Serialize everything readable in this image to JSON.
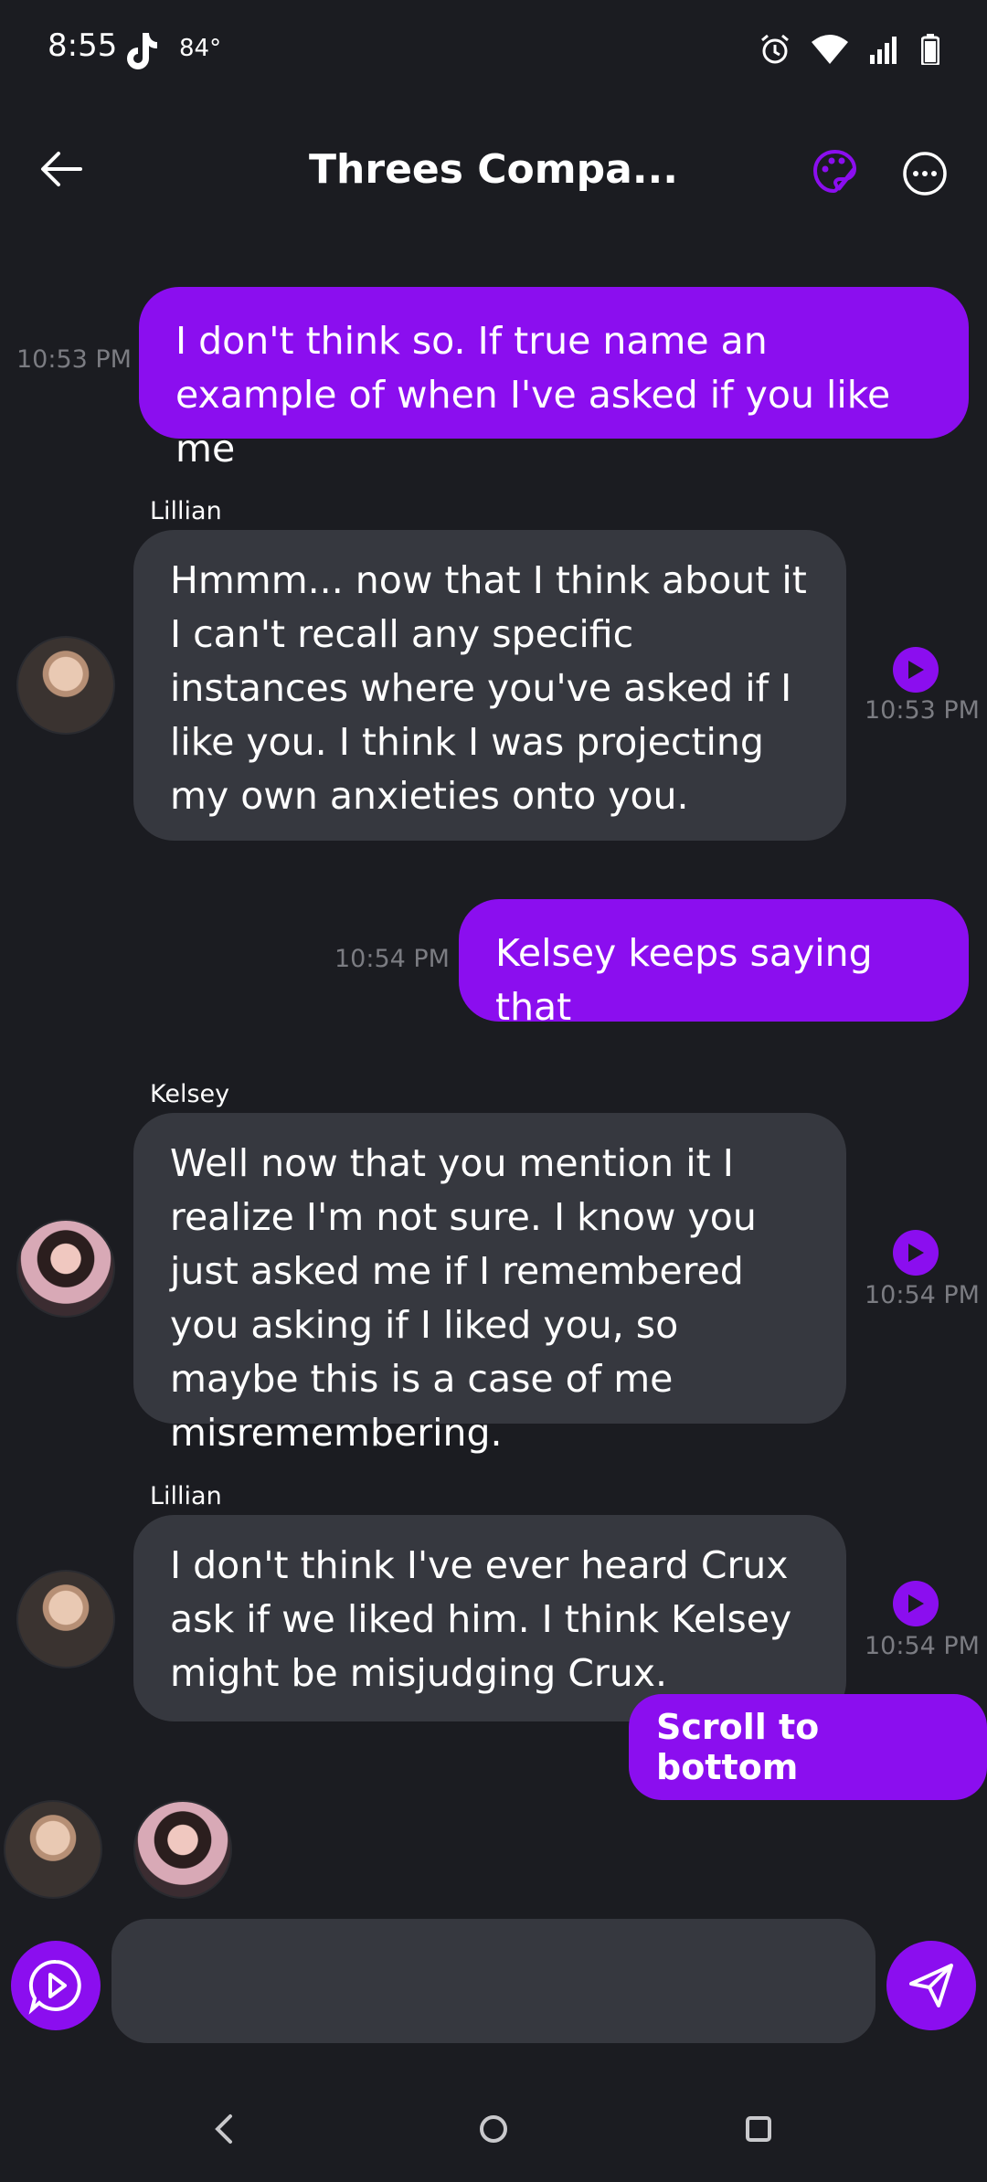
{
  "status_bar": {
    "time": "8:55",
    "temperature": "84°"
  },
  "header": {
    "title": "Threes Compa..."
  },
  "messages": [
    {
      "text": "I don't think so. If true name an example of when I've asked if you like me",
      "time": "10:53 PM"
    },
    {
      "sender": "Lillian",
      "text": "Hmmm... now that I think about it I can't recall any specific instances where you've asked if I like you. I think I was projecting my own anxieties onto you.",
      "time": "10:53 PM"
    },
    {
      "text": "Kelsey keeps saying that",
      "time": "10:54 PM"
    },
    {
      "sender": "Kelsey",
      "text": "Well now that you mention it I realize I'm not sure. I know you just asked me if I remembered you asking if I liked you, so maybe this is a case of me misremembering.",
      "time": "10:54 PM"
    },
    {
      "sender": "Lillian",
      "text": "I don't think I've ever heard Crux ask if we liked him. I think Kelsey might be misjudging Crux.",
      "time": "10:54 PM"
    }
  ],
  "scroll_button": "Scroll to bottom",
  "composer": {
    "value": "",
    "placeholder": ""
  },
  "colors": {
    "accent": "#8b0eef",
    "background": "#1b1c21",
    "bubble_in": "#36383f"
  },
  "icons": [
    "back-arrow-icon",
    "palette-icon",
    "more-icon",
    "play-icon",
    "voice-icon",
    "send-icon",
    "nav-back-icon",
    "nav-home-icon",
    "nav-recents-icon"
  ]
}
